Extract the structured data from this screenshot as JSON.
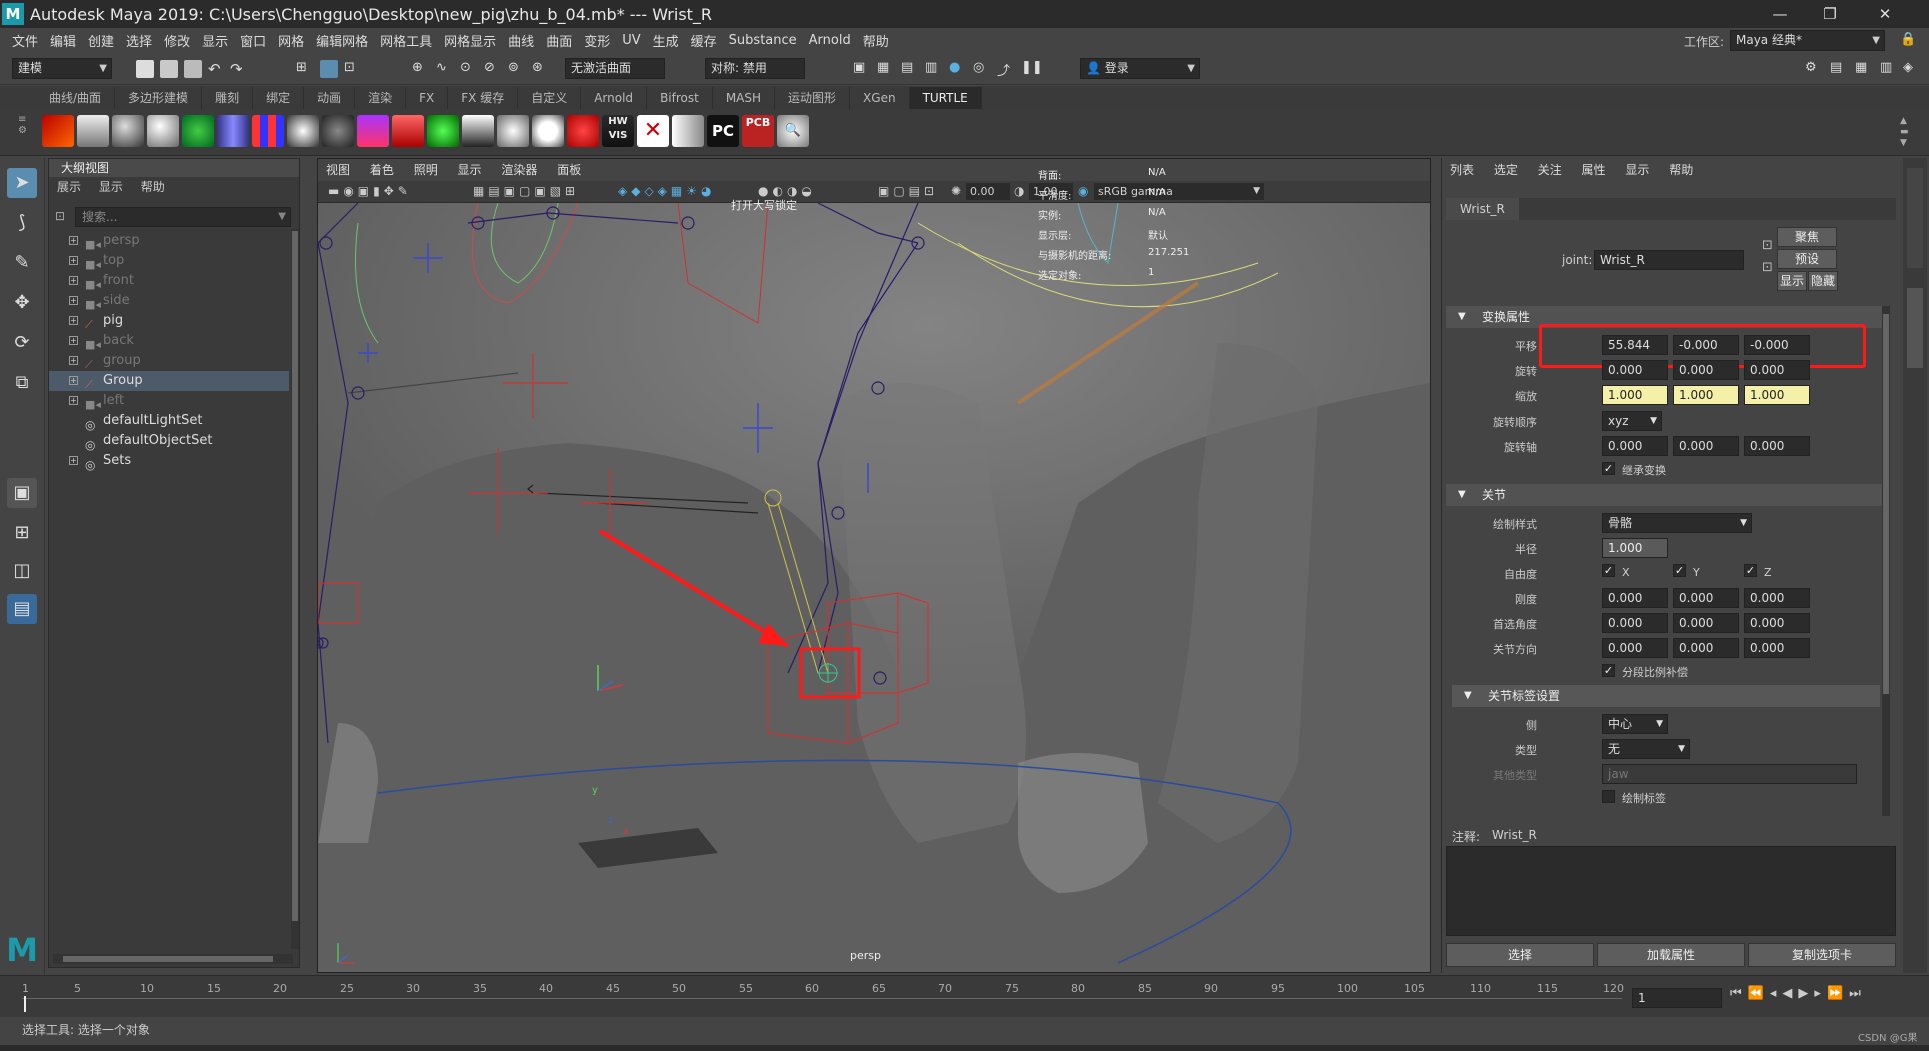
{
  "window": {
    "title": "Autodesk Maya 2019: C:\\Users\\Chengguo\\Desktop\\new_pig\\zhu_b_04.mb*  ---  Wrist_R",
    "minimize": "—",
    "restore": "❐",
    "close": "✕"
  },
  "menubar": {
    "items": [
      "文件",
      "编辑",
      "创建",
      "选择",
      "修改",
      "显示",
      "窗口",
      "网格",
      "编辑网格",
      "网格工具",
      "网格显示",
      "曲线",
      "曲面",
      "变形",
      "UV",
      "生成",
      "缓存",
      "Substance",
      "Arnold",
      "帮助"
    ],
    "workspace_label": "工作区:",
    "workspace_value": "Maya 经典*"
  },
  "status": {
    "mode": "建模",
    "live_surface": "无激活曲面",
    "symmetry": "对称: 禁用",
    "login": "登录"
  },
  "shelf": {
    "tabs": [
      "曲线/曲面",
      "多边形建模",
      "雕刻",
      "绑定",
      "动画",
      "渲染",
      "FX",
      "FX 缓存",
      "自定义",
      "Arnold",
      "Bifrost",
      "MASH",
      "运动图形",
      "XGen",
      "TURTLE"
    ],
    "active_tab": "TURTLE",
    "icon_labels": [
      "HW VIS",
      "PC",
      "PCB"
    ]
  },
  "outliner": {
    "title": "大纲视图",
    "menu": [
      "展示",
      "显示",
      "帮助"
    ],
    "search_placeholder": "搜索...",
    "items": [
      {
        "label": "persp",
        "dim": true
      },
      {
        "label": "top",
        "dim": true
      },
      {
        "label": "front",
        "dim": true
      },
      {
        "label": "side",
        "dim": true
      },
      {
        "label": "pig",
        "dim": false
      },
      {
        "label": "back",
        "dim": true
      },
      {
        "label": "group",
        "dim": true
      },
      {
        "label": "Group",
        "dim": false
      },
      {
        "label": "left",
        "dim": true
      },
      {
        "label": "defaultLightSet",
        "dim": false
      },
      {
        "label": "defaultObjectSet",
        "dim": false
      },
      {
        "label": "Sets",
        "dim": false
      }
    ]
  },
  "viewport": {
    "menu": [
      "视图",
      "着色",
      "照明",
      "显示",
      "渲染器",
      "面板"
    ],
    "exposure": "0.00",
    "gamma": "1.00",
    "colorspace": "sRGB gamma",
    "hud_labels": [
      "背面:",
      "平滑度:",
      "实例:",
      "显示层:",
      "与摄影机的距离:",
      "选定对象:"
    ],
    "hud_values": [
      "N/A",
      "N/A",
      "N/A",
      "默认",
      "217.251",
      "1"
    ],
    "hud_note": "打开大写锁定",
    "camera": "persp",
    "axis_y": "y",
    "axis_x": "x",
    "axis_z": "z"
  },
  "attr": {
    "menu": [
      "列表",
      "选定",
      "关注",
      "属性",
      "显示",
      "帮助"
    ],
    "node_tab": "Wrist_R",
    "joint_label": "joint:",
    "joint_value": "Wrist_R",
    "buttons": {
      "focus": "聚焦",
      "presets": "预设",
      "show": "显示",
      "hide": "隐藏"
    },
    "transform_section": "变换属性",
    "translate_label": "平移",
    "translate": [
      "55.844",
      "-0.000",
      "-0.000"
    ],
    "rotate_label": "旋转",
    "rotate": [
      "0.000",
      "0.000",
      "0.000"
    ],
    "scale_label": "缩放",
    "scale": [
      "1.000",
      "1.000",
      "1.000"
    ],
    "rotate_order_label": "旋转顺序",
    "rotate_order": "xyz",
    "rotate_axis_label": "旋转轴",
    "rotate_axis": [
      "0.000",
      "0.000",
      "0.000"
    ],
    "inherit_label": "继承变换",
    "joint_section": "关节",
    "draw_style_label": "绘制样式",
    "draw_style": "骨骼",
    "radius_label": "半径",
    "radius": "1.000",
    "dof_label": "自由度",
    "dof": [
      "X",
      "Y",
      "Z"
    ],
    "stiffness_label": "刚度",
    "stiffness": [
      "0.000",
      "0.000",
      "0.000"
    ],
    "preferred_label": "首选角度",
    "preferred": [
      "0.000",
      "0.000",
      "0.000"
    ],
    "orient_label": "关节方向",
    "orient": [
      "0.000",
      "0.000",
      "0.000"
    ],
    "segment_label": "分段比例补偿",
    "labelling_section": "关节标签设置",
    "side_label": "侧",
    "side": "中心",
    "type_label": "类型",
    "type": "无",
    "other_type_label": "其他类型",
    "other_type": "jaw",
    "draw_label": "绘制标签",
    "notes_label": "注释:",
    "notes_node": "Wrist_R",
    "bottom_buttons": [
      "选择",
      "加载属性",
      "复制选项卡"
    ]
  },
  "timeline": {
    "ticks": [
      "5",
      "10",
      "15",
      "20",
      "25",
      "30",
      "35",
      "40",
      "45",
      "50",
      "55",
      "60",
      "65",
      "70",
      "75",
      "80",
      "85",
      "90",
      "95",
      "100",
      "105",
      "110",
      "115",
      "120"
    ],
    "start_tick": "1",
    "current_frame": "1"
  },
  "help": {
    "text": "选择工具: 选择一个对象",
    "watermark": "CSDN @G果"
  },
  "colors": {
    "accent": "#5ab0e0",
    "highlight_red": "#ff1a1a",
    "yellow_field": "#f5f0a8"
  }
}
